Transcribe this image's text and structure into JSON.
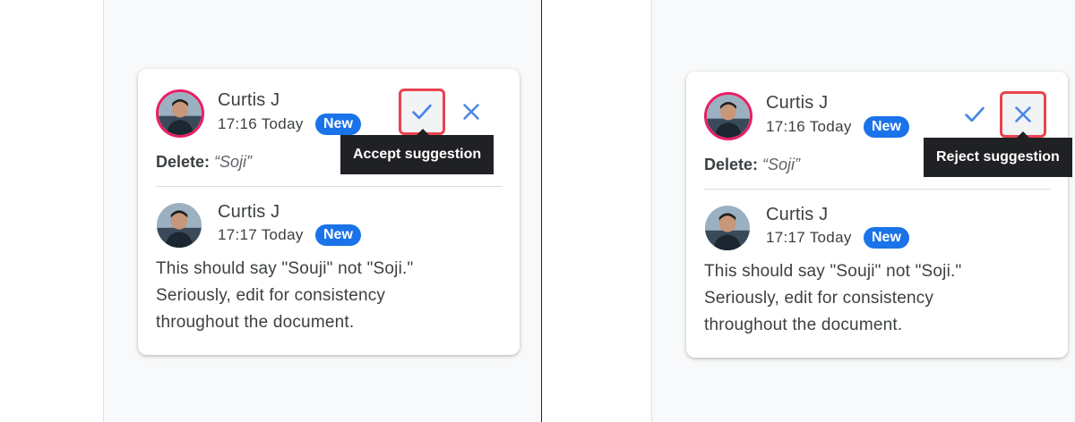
{
  "panels": [
    {
      "id": "left",
      "suggestion": {
        "author": "Curtis J",
        "time": "17:16 Today",
        "badge": "New",
        "delete_label": "Delete:",
        "delete_value": "“Soji”"
      },
      "reply": {
        "author": "Curtis J",
        "time": "17:17 Today",
        "badge": "New",
        "text_lines": [
          "This should say \"Souji\" not \"Soji.\"",
          "Seriously, edit for consistency",
          "throughout the document."
        ]
      },
      "tooltip": "Accept suggestion",
      "highlighted_action": "accept"
    },
    {
      "id": "right",
      "suggestion": {
        "author": "Curtis J",
        "time": "17:16 Today",
        "badge": "New",
        "delete_label": "Delete:",
        "delete_value": "“Soji”"
      },
      "reply": {
        "author": "Curtis J",
        "time": "17:17 Today",
        "badge": "New",
        "text_lines": [
          "This should say \"Souji\" not \"Soji.\"",
          "Seriously, edit for consistency",
          "throughout the document."
        ]
      },
      "tooltip": "Reject suggestion",
      "highlighted_action": "reject"
    }
  ],
  "colors": {
    "accent": "#1a73e8",
    "highlight_border": "#e8434f",
    "avatar_ring": "#e91e63",
    "icon_blue": "#4a86e8",
    "tooltip_bg": "#202124"
  },
  "icons": {
    "accept": "check-icon",
    "reject": "close-icon"
  }
}
